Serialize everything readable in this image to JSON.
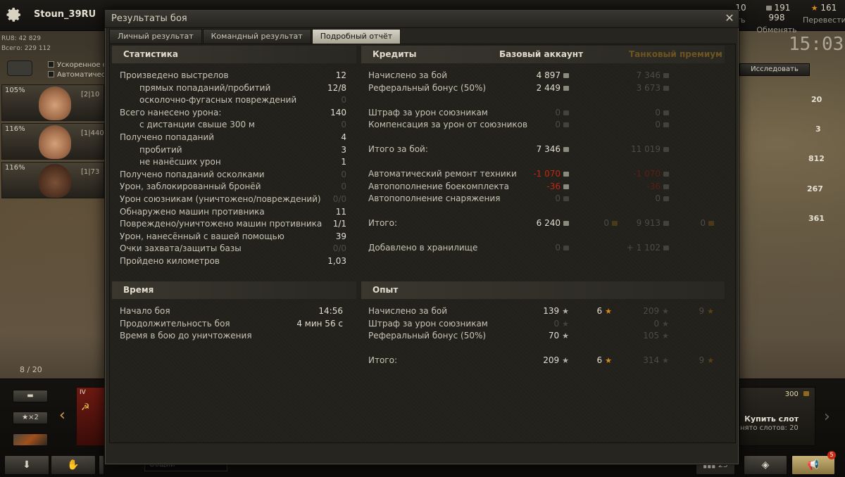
{
  "client": {
    "username": "Stoun_39RU",
    "rub_line1": "RU8: 42 829",
    "rub_line2": "Всего: 229 112",
    "crew_options": [
      "Ускоренное о",
      "Автоматичес"
    ],
    "crew": [
      {
        "pct": "105%",
        "num": "[2|10"
      },
      {
        "pct": "116%",
        "num": "[1|440"
      },
      {
        "pct": "116%",
        "num": "[1|73"
      }
    ],
    "currencies": [
      {
        "value": "10",
        "sub": "ть"
      },
      {
        "value": "191 998",
        "sub": "Обменять"
      },
      {
        "value": "161",
        "sub": "Перевести"
      }
    ],
    "research_button": "Исследовать",
    "clock": "15:03",
    "right_stats": [
      "20",
      "3",
      "812",
      "267",
      "361"
    ],
    "carousel_count": "8 / 20",
    "ammo_button": "×2",
    "buy_slot": {
      "price": "300",
      "title": "Купить слот",
      "sub": "нято слотов: 20"
    },
    "chat_placeholder": "Общий",
    "bottom_counter": "25",
    "notif_count": "5",
    "tank_tier": "IV"
  },
  "modal": {
    "title": "Результаты боя",
    "tabs": [
      "Личный результат",
      "Командный результат",
      "Подробный отчёт"
    ],
    "active_tab": 2,
    "statistics": {
      "header": "Статистика",
      "rows": [
        {
          "label": "Произведено выстрелов",
          "value": "12",
          "indent": false,
          "dim": false
        },
        {
          "label": "прямых попаданий/пробитий",
          "value": "12/8",
          "indent": true,
          "dim": false
        },
        {
          "label": "осколочно-фугасных повреждений",
          "value": "0",
          "indent": true,
          "dim": true
        },
        {
          "label": "Всего нанесено урона:",
          "value": "140",
          "indent": false,
          "dim": false
        },
        {
          "label": "с дистанции свыше 300 м",
          "value": "0",
          "indent": true,
          "dim": true
        },
        {
          "label": "Получено попаданий",
          "value": "4",
          "indent": false,
          "dim": false
        },
        {
          "label": "пробитий",
          "value": "3",
          "indent": true,
          "dim": false
        },
        {
          "label": "не нанёсших урон",
          "value": "1",
          "indent": true,
          "dim": false
        },
        {
          "label": "Получено попаданий осколками",
          "value": "0",
          "indent": false,
          "dim": true
        },
        {
          "label": "Урон, заблокированный бронёй",
          "value": "0",
          "indent": false,
          "dim": true
        },
        {
          "label": "Урон союзникам (уничтожено/повреждений)",
          "value": "0/0",
          "indent": false,
          "dim": true
        },
        {
          "label": "Обнаружено машин противника",
          "value": "11",
          "indent": false,
          "dim": false
        },
        {
          "label": "Повреждено/уничтожено машин противника",
          "value": "1/1",
          "indent": false,
          "dim": false
        },
        {
          "label": "Урон, нанесённый с вашей помощью",
          "value": "39",
          "indent": false,
          "dim": false
        },
        {
          "label": "Очки захвата/защиты базы",
          "value": "0/0",
          "indent": false,
          "dim": true
        },
        {
          "label": "Пройдено километров",
          "value": "1,03",
          "indent": false,
          "dim": false
        }
      ]
    },
    "time": {
      "header": "Время",
      "rows": [
        {
          "label": "Начало боя",
          "value": "14:56"
        },
        {
          "label": "Продолжительность боя",
          "value": "4 мин 56 с"
        },
        {
          "label": "Время в бою до уничтожения",
          "value": ""
        }
      ]
    },
    "credits": {
      "header": "Кредиты",
      "col_base": "Базовый аккаунт",
      "col_premium": "Танковый премиум",
      "rows": [
        {
          "label": "Начислено за бой",
          "base": "4 897",
          "base_gold": "",
          "prem": "7 346",
          "prem_gold": "",
          "base_style": "normal",
          "group": 0
        },
        {
          "label": "Реферальный бонус (50%)",
          "base": "2 449",
          "base_gold": "",
          "prem": "3 673",
          "prem_gold": "",
          "base_style": "normal",
          "group": 0
        },
        {
          "label": "Штраф за урон союзникам",
          "base": "0",
          "base_gold": "",
          "prem": "0",
          "prem_gold": "",
          "base_style": "dim",
          "group": 1
        },
        {
          "label": "Компенсация за урон от союзников",
          "base": "0",
          "base_gold": "",
          "prem": "0",
          "prem_gold": "",
          "base_style": "dim",
          "group": 1
        },
        {
          "label": "Итого за бой:",
          "base": "7 346",
          "base_gold": "",
          "prem": "11 019",
          "prem_gold": "",
          "base_style": "normal",
          "group": 2
        },
        {
          "label": "Автоматический ремонт техники",
          "base": "-1 070",
          "base_gold": "",
          "prem": "-1 070",
          "prem_gold": "",
          "base_style": "red",
          "group": 3
        },
        {
          "label": "Автопополнение боекомплекта",
          "base": "-36",
          "base_gold": "",
          "prem": "-36",
          "prem_gold": "",
          "base_style": "red",
          "group": 3
        },
        {
          "label": "Автопополнение снаряжения",
          "base": "0",
          "base_gold": "",
          "prem": "0",
          "prem_gold": "",
          "base_style": "dim",
          "group": 3
        },
        {
          "label": "Итого:",
          "base": "6 240",
          "base_gold": "0",
          "prem": "9 913",
          "prem_gold": "0",
          "base_style": "normal",
          "group": 4
        },
        {
          "label": "Добавлено в хранилище",
          "base": "0",
          "base_gold": "",
          "prem": "+ 1 102",
          "prem_gold": "",
          "base_style": "dim",
          "group": 5
        }
      ]
    },
    "experience": {
      "header": "Опыт",
      "rows": [
        {
          "label": "Начислено за бой",
          "base": "139",
          "base_free": "6",
          "prem": "209",
          "prem_free": "9",
          "base_style": "normal"
        },
        {
          "label": "Штраф за урон союзникам",
          "base": "0",
          "base_free": "",
          "prem": "0",
          "prem_free": "",
          "base_style": "dim"
        },
        {
          "label": "Реферальный бонус (50%)",
          "base": "70",
          "base_free": "",
          "prem": "105",
          "prem_free": "",
          "base_style": "normal"
        },
        {
          "label": "Итого:",
          "base": "209",
          "base_free": "6",
          "prem": "314",
          "prem_free": "9",
          "base_style": "normal"
        }
      ]
    }
  }
}
